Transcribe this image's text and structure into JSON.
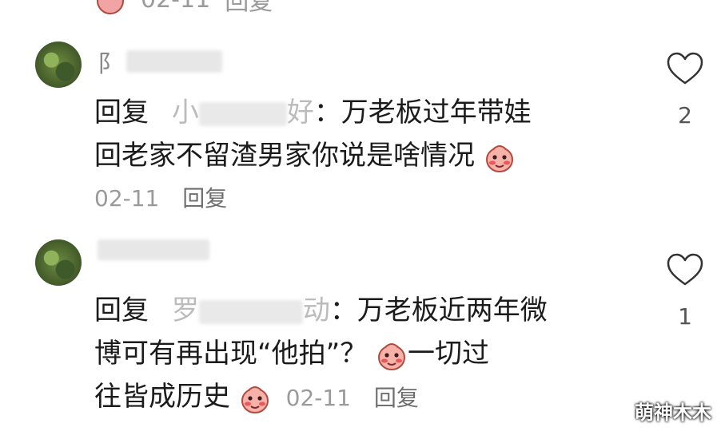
{
  "top": {
    "meta_reply": "回复",
    "meta_date": "02-11"
  },
  "comments": [
    {
      "name_visible": "阝",
      "reply_prefix": "回复",
      "reply_target_start": "小",
      "reply_target_end": "好",
      "text_line1": "：万老板过年带娃",
      "text_line2": "回老家不留渣男家你说是啥情况",
      "date": "02-11",
      "reply_label": "回复",
      "like_count": "2"
    },
    {
      "reply_prefix": "回复",
      "reply_target_start": "罗",
      "reply_target_end": "动",
      "text_line1": "：万老板近两年微",
      "text_line2": "博可有再出现“他拍”？",
      "text_line2b": "一切过",
      "text_line3": "往皆成历史",
      "date": "02-11",
      "reply_label": "回复",
      "like_count": "1"
    }
  ],
  "watermark": "萌神木木",
  "colors": {
    "meta": "#9a9a9a",
    "text": "#1b1b1b"
  }
}
